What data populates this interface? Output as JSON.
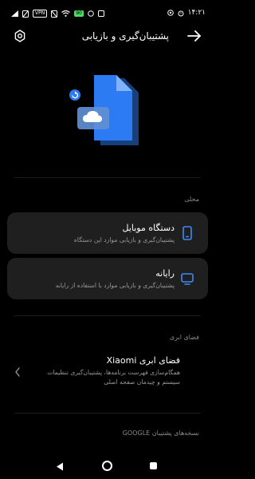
{
  "status_bar": {
    "time": "۱۴:۲۱",
    "battery": "90",
    "vpn": "VPN",
    "icons": [
      "photo-icon",
      "whatsapp-icon",
      "battery-icon",
      "wifi-icon",
      "no-sim-icon",
      "vpn-icon",
      "bluetooth-icon",
      "cellular-icon",
      "alarm-icon",
      "location-icon"
    ]
  },
  "header": {
    "title": "پشتیبان‌گیری و بازیابی",
    "back_icon": "arrow-right-icon",
    "settings_icon": "gear-icon"
  },
  "hero": {
    "icon": "files-backup-illustration",
    "accent": "#2c7bf2"
  },
  "local": {
    "label": "محلی",
    "items": [
      {
        "title": "دستگاه موبایل",
        "subtitle": "پشتیبان‌گیری و بازیابی موارد این دستگاه",
        "icon": "phone-icon"
      },
      {
        "title": "رایانه",
        "subtitle": "پشتیبان‌گیری و بازیابی موارد با استفاده از رایانه",
        "icon": "monitor-icon"
      }
    ]
  },
  "cloud": {
    "label": "فضای ابری",
    "title": "فضای ابری Xiaomi",
    "subtitle": "همگام‌سازی فهرست برنامه‌ها، پشتیبان‌گیری تنظیمات سیستم و چیدمان صفحه اصلی"
  },
  "google": {
    "label": "نسخه‌های پشتیبان GOOGLE"
  },
  "colors": {
    "background": "#000000",
    "card": "#1f1f1f",
    "accent": "#3d8bf5",
    "muted": "#8a8a8a"
  }
}
